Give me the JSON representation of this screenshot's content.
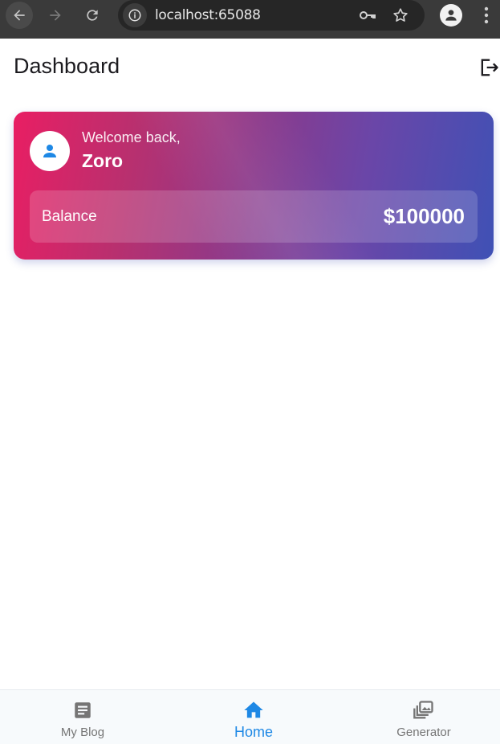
{
  "browser": {
    "url": "localhost:65088",
    "icons": [
      "back-arrow-icon",
      "forward-arrow-icon",
      "reload-icon",
      "info-icon",
      "key-icon",
      "star-icon",
      "profile-icon",
      "more-vert-icon"
    ]
  },
  "header": {
    "title": "Dashboard",
    "logout_icon": "logout-icon"
  },
  "card": {
    "welcome": "Welcome back,",
    "username": "Zoro",
    "balance_label": "Balance",
    "balance_value": "$100000",
    "gradient_start": "#e91e63",
    "gradient_end": "#3f51b5"
  },
  "bottom_nav": {
    "items": [
      {
        "label": "My Blog",
        "icon": "article-icon",
        "active": false
      },
      {
        "label": "Home",
        "icon": "home-icon",
        "active": true
      },
      {
        "label": "Generator",
        "icon": "collections-icon",
        "active": false
      }
    ],
    "active_color": "#1e88e5",
    "inactive_color": "#757575"
  }
}
